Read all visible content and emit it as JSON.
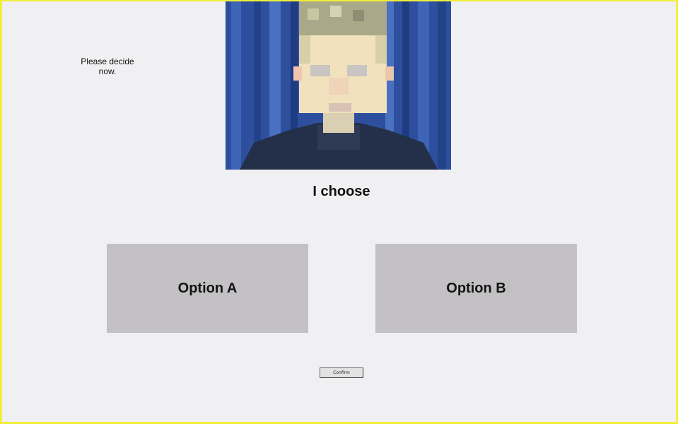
{
  "prompt": {
    "line1": "Please decide",
    "line2": "now."
  },
  "video": {
    "icon": "webcam-video-feed"
  },
  "heading": "I choose",
  "options": [
    {
      "label": "Option A"
    },
    {
      "label": "Option B"
    }
  ],
  "confirm_label": "Confirm",
  "colors": {
    "frame_border": "#f2ef3a",
    "background": "#f0eff1",
    "option_fill": "#c3c1c4"
  }
}
